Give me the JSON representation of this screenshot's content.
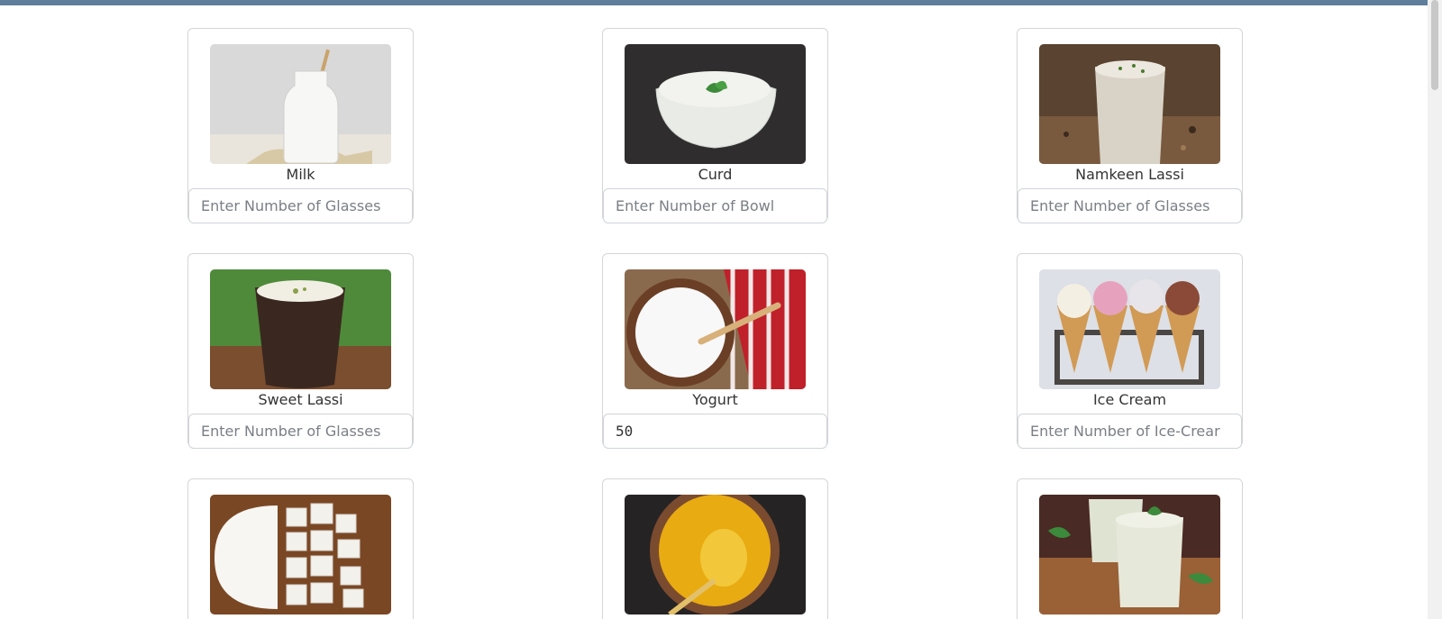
{
  "products": [
    {
      "label": "Milk",
      "placeholder": "Enter Number of Glasses",
      "value": "",
      "image_icon": "milk-bottle-icon"
    },
    {
      "label": "Curd",
      "placeholder": "Enter Number of Bowl",
      "value": "",
      "image_icon": "curd-bowl-icon"
    },
    {
      "label": "Namkeen Lassi",
      "placeholder": "Enter Number of Glasses",
      "value": "",
      "image_icon": "lassi-glass-icon"
    },
    {
      "label": "Sweet Lassi",
      "placeholder": "Enter Number of Glasses",
      "value": "",
      "image_icon": "sweet-lassi-icon"
    },
    {
      "label": "Yogurt",
      "placeholder": "",
      "value": "50",
      "image_icon": "yogurt-bowl-icon"
    },
    {
      "label": "Ice Cream",
      "placeholder": "Enter Number of Ice-Crear",
      "value": "",
      "image_icon": "ice-cream-cones-icon"
    },
    {
      "image_icon": "paneer-cubes-icon"
    },
    {
      "image_icon": "ghee-bowl-icon"
    },
    {
      "image_icon": "buttermilk-glasses-icon"
    }
  ],
  "colors": {
    "top_bar": "#5f7e9c",
    "border": "#d6d6d6"
  }
}
